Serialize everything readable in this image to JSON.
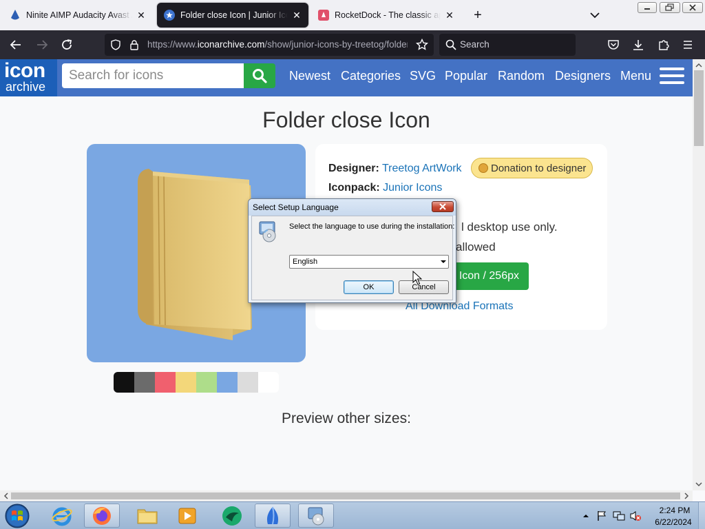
{
  "browser": {
    "tabs": [
      {
        "title": "Ninite AIMP Audacity Avast AVG",
        "icon": "ninite-favicon-icon",
        "active": false
      },
      {
        "title": "Folder close Icon | Junior Iconpack",
        "icon": "star-favicon-icon",
        "active": true
      },
      {
        "title": "RocketDock - The classic app launcher",
        "icon": "rocketdock-favicon-icon",
        "active": false
      }
    ],
    "new_tab": "+",
    "url_prefix": "https://www.",
    "url_domain": "iconarchive.com",
    "url_path": "/show/junior-icons-by-treetog/folder-close-icon.html",
    "search_placeholder": "Search",
    "colors": {
      "tabstrip": "#f0f0f4",
      "toolbar": "#2b2a33",
      "urlbar": "#1c1b22"
    }
  },
  "site": {
    "logo_line1": "icon",
    "logo_line2": "archive",
    "search_placeholder": "Search for icons",
    "nav": [
      "Newest",
      "Categories",
      "SVG",
      "Popular",
      "Random",
      "Designers"
    ],
    "menu_label": "Menu",
    "colors": {
      "header": "#4472c4",
      "accent_green": "#28a745",
      "link": "#1a73b8"
    }
  },
  "page": {
    "title": "Folder close Icon",
    "designer_label": "Designer:",
    "designer_value": "Treetog ArtWork",
    "donation": "Donation to designer",
    "iconpack_label": "Iconpack:",
    "iconpack_value": "Junior Icons",
    "license_line1": "l desktop use only.",
    "license_line2": "allowed",
    "download_label": "Icon / 256px",
    "all_formats": "All Download Formats",
    "preview_sizes": "Preview other sizes:",
    "swatches": [
      "#111111",
      "#6b6b6b",
      "#f0606e",
      "#f3d77a",
      "#aedd8a",
      "#7aa7e2",
      "#dcdcdc",
      "#ffffff"
    ],
    "preview_bg": "#7aa7e2"
  },
  "dialog": {
    "title": "Select Setup Language",
    "message": "Select the language to use during the installation:",
    "selected_language": "English",
    "ok": "OK",
    "cancel": "Cancel"
  },
  "taskbar": {
    "apps": [
      "internet-explorer-icon",
      "firefox-icon",
      "file-explorer-icon",
      "media-player-icon",
      "green-app-icon",
      "blue-sail-app-icon",
      "setup-installer-icon"
    ],
    "time": "2:24 PM",
    "date": "6/22/2024"
  }
}
